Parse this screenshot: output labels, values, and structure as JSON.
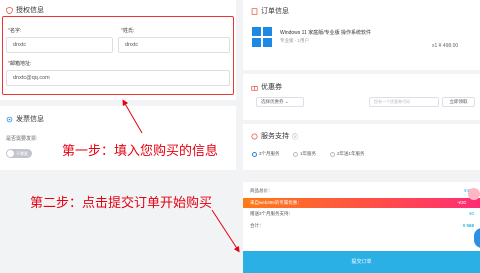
{
  "auth": {
    "title": "授权信息",
    "name_label": "名字:",
    "name_value": "dnxtc",
    "surname_label": "姓氏:",
    "surname_value": "dnxtc",
    "email_label": "邮箱地址:",
    "email_value": "dnxtc@qq.com"
  },
  "invoice": {
    "title": "发票信息",
    "need_label": "是否需要发票:",
    "toggle_text": "不需要"
  },
  "order": {
    "title": "订单信息",
    "product_name": "Windows 11 家庭版/专业版 操作系统软件",
    "product_sub": "专业版 - 1用户",
    "price": "x1  ¥ 498.00"
  },
  "coupon": {
    "title": "优惠券",
    "select_label": "选择优惠券",
    "input_placeholder": "您有一个优惠券代码",
    "apply_button": "立即领取"
  },
  "service": {
    "title": "服务支持",
    "options": [
      "3个月服务",
      "1年服务",
      "2年送1年服务"
    ]
  },
  "summary": {
    "subtotal_label": "商品总价：",
    "subtotal_value": "¥498",
    "promo_text": "来自web386的专属优惠：",
    "promo_value": "-¥30",
    "service_label": "赠送3个月服务支持：",
    "service_value": "¥0",
    "total_label": "合计：",
    "total_value": "¥ 568",
    "submit_label": "提交订单"
  },
  "annotations": {
    "step1": "第一步：填入您购买的信息",
    "step2": "第二步：点击提交订单开始购买"
  },
  "colors": {
    "accent": "#2bb0e6",
    "annotation": "#e60012",
    "promo_start": "#ff7a18",
    "promo_end": "#ff2d75"
  }
}
